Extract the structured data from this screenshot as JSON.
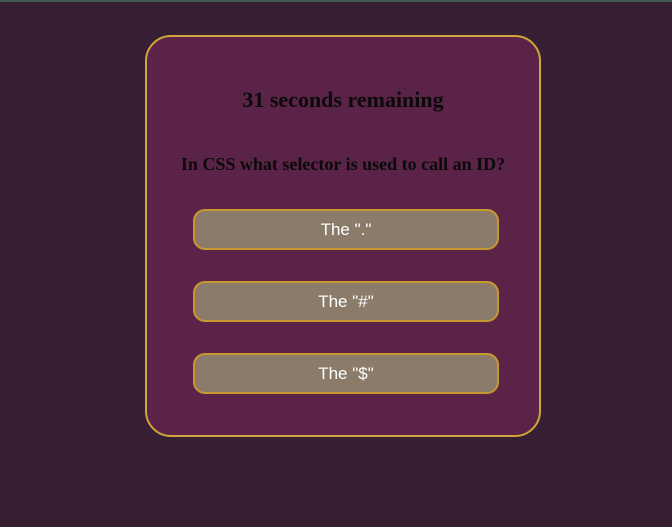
{
  "quiz": {
    "timer_text": "31 seconds remaining",
    "question": "In CSS what selector is used to call an ID?",
    "answers": [
      "The \".\"",
      "The \"#\"",
      "The \"$\""
    ]
  },
  "colors": {
    "page_background": "#371f33",
    "card_background": "#5a2347",
    "card_border": "#d0a43b",
    "answer_background": "#8a7b6b",
    "answer_border": "#c9982f",
    "answer_text": "#ffffff"
  }
}
